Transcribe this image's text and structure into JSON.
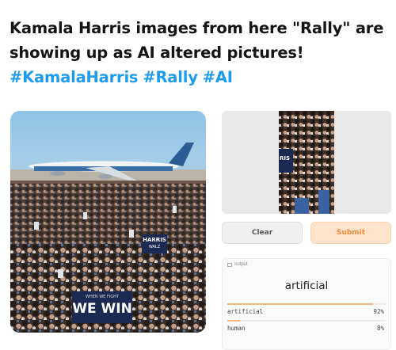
{
  "post": {
    "line1": "Kamala Harris images from here \"Rally\" are",
    "line2": "showing up as AI altered pictures!",
    "hashtags": [
      "#KamalaHarris",
      "#Rally",
      "#AI"
    ]
  },
  "photo": {
    "sign_small_1": "HARRIS",
    "sign_small_2": "WALZ",
    "sign_big_sub": "WHEN WE FIGHT",
    "sign_big": "WE WIN"
  },
  "input_thumb": {
    "sign_text": "RIS"
  },
  "buttons": {
    "clear": "Clear",
    "submit": "Submit"
  },
  "output": {
    "tag": "output",
    "top_label": "artificial",
    "rows": [
      {
        "label": "artificial",
        "value": "92%",
        "fraction": 0.92
      },
      {
        "label": "human",
        "value": "8%",
        "fraction": 0.08
      }
    ]
  },
  "colors": {
    "hashtag": "#1d9bf0",
    "submit_bg": "#fde3cc",
    "submit_text": "#f08a3a",
    "bar": "#f4b47c"
  }
}
